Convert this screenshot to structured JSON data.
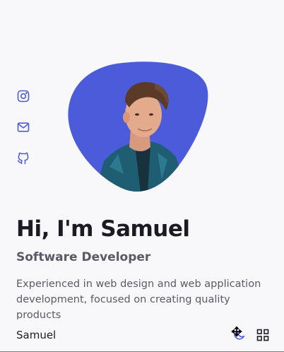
{
  "social": {
    "items": [
      {
        "icon": "instagram-icon"
      },
      {
        "icon": "mail-icon"
      },
      {
        "icon": "github-icon"
      }
    ]
  },
  "hero": {
    "photo_alt": "Portrait of Samuel",
    "title": "Hi, I'm Samuel",
    "subtitle": "Software Developer",
    "description": "Experienced in web design and web application development, focused on creating quality products"
  },
  "header": {
    "brand": "Samuel",
    "theme_icon": "moon-icon",
    "menu_icon": "grid-icon"
  },
  "colors": {
    "accent": "#4b5bd9",
    "background": "#f8f8fb",
    "title": "#1b1b24",
    "text": "#5a5a66"
  }
}
